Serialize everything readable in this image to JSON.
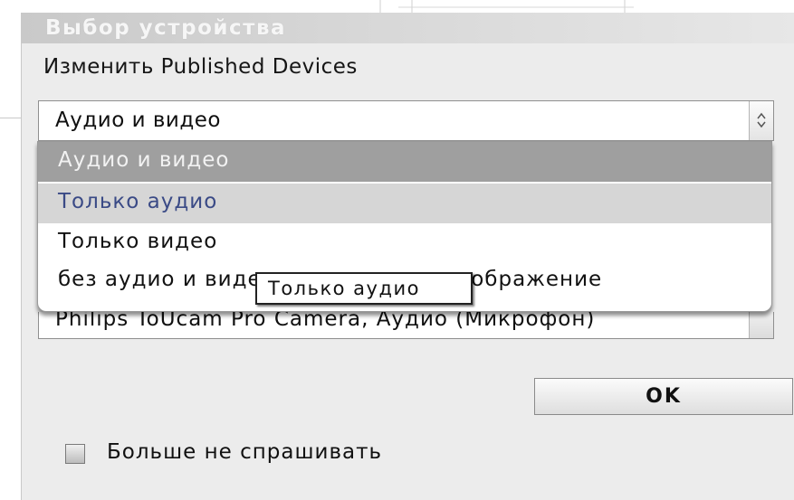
{
  "dialog": {
    "title": "Выбор устройства",
    "change_label": "Изменить Published Devices"
  },
  "mode_select": {
    "value": "Аудио и видео",
    "options": [
      {
        "label": "Аудио и видео",
        "state": "selected"
      },
      {
        "label": "Только аудио",
        "state": "hover"
      },
      {
        "label": "Только видео",
        "state": "normal"
      },
      {
        "label": "без аудио и видео: статическое изображение",
        "state": "normal"
      }
    ]
  },
  "device_select": {
    "value": "Philips ToUcam Pro Camera, Аудио (Микрофон)"
  },
  "tooltip": {
    "text": "Только аудио"
  },
  "ok_button": {
    "label": "OK"
  },
  "dont_ask": {
    "label": "Больше не спрашивать",
    "checked": false
  },
  "colors": {
    "title_text": "#f6f6f6",
    "selected_option_bg": "#9f9f9f",
    "hover_option_bg": "#d6d6d6",
    "hover_option_text": "#3a4a86"
  }
}
